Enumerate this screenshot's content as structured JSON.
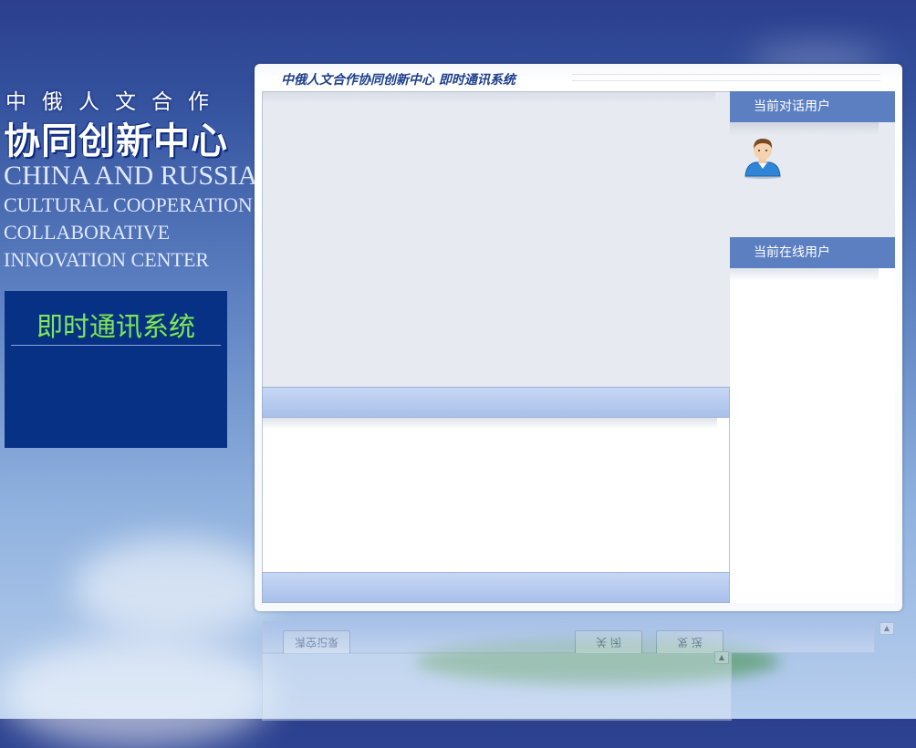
{
  "brand": {
    "cn_top": "中俄人文合作",
    "cn_big": "协同创新中心",
    "en_lines": [
      "CHINA AND RUSSIA",
      "CULTURAL COOPERATION",
      "COLLABORATIVE",
      "INNOVATION CENTER"
    ]
  },
  "sidebar": {
    "title": "即时通讯系统"
  },
  "window": {
    "title": "中俄人文合作协同创新中心 即时通讯系统"
  },
  "panels": {
    "dialog_users_label": "当前对话用户",
    "online_users_label": "当前在线用户"
  },
  "reflection": {
    "clear_label": "清空记录",
    "close_label": "关 闭",
    "send_label": "发 送"
  },
  "colors": {
    "background_top": "#2b3f8e",
    "sidebar_box": "#073185",
    "sidebar_title": "#7fe36c",
    "panel_header": "#5b7fc0",
    "chat_area": "#e7eaf0"
  }
}
